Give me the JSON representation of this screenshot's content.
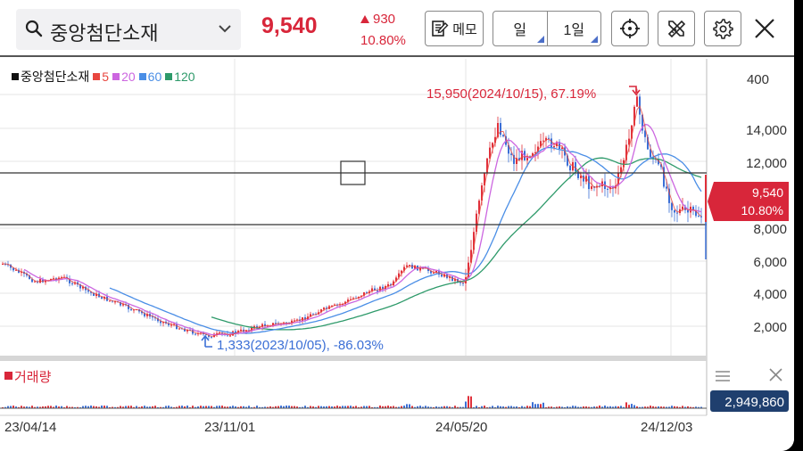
{
  "toolbar": {
    "stock_name": "중앙첨단소재",
    "price": "9,540",
    "change_abs": "930",
    "change_pct": "10.80%",
    "memo_label": "메모",
    "period_day": "일",
    "period_range": "1일"
  },
  "legend": {
    "name": "중앙첨단소재",
    "ma5": "5",
    "ma20": "20",
    "ma60": "60",
    "ma120": "120",
    "colors": {
      "ma5": "#e8463f",
      "ma20": "#cc66e0",
      "ma60": "#4a8ee6",
      "ma120": "#2e9a6a"
    }
  },
  "price_axis": [
    "400",
    "14,000",
    "12,000",
    "8,000",
    "6,000",
    "4,000",
    "2,000"
  ],
  "current_price_tag": {
    "price": "9,540",
    "pct": "10.80%"
  },
  "annotations": {
    "high": "15,950(2024/10/15), 67.19%",
    "low": "1,333(2023/10/05), -86.03%"
  },
  "volume": {
    "label": "거래량",
    "value": "2,949,860"
  },
  "x_axis": [
    "23/04/14",
    "23/11/01",
    "24/05/20",
    "24/12/03"
  ],
  "colors": {
    "up": "#e0303a",
    "down": "#3b6fd6",
    "accent": "#d8263a"
  }
}
